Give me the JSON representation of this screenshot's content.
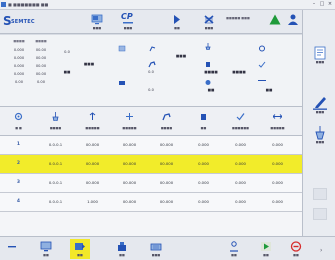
{
  "window": {
    "title": "■ ■■■■■■■ ■■",
    "controls": [
      "–",
      "□",
      "×"
    ]
  },
  "logo": {
    "letter": "S",
    "text": "SEMTEC"
  },
  "toolbar": {
    "items": [
      {
        "label": "■■■",
        "icon": "display-icon"
      },
      {
        "label": "■■■",
        "icon": "cp-icon",
        "glyph": "CP"
      },
      {
        "label": "■■",
        "icon": "arrow-right-icon"
      },
      {
        "label": "■■■",
        "icon": "trash-icon"
      },
      {
        "label": "■■■■■",
        "icon": "status-text"
      },
      {
        "label": "■■",
        "icon": "warning-triangle-icon"
      },
      {
        "label": "■■■",
        "icon": "user-icon"
      }
    ],
    "status_text": "■■■■■ ■■■"
  },
  "panel": {
    "left_headers": [
      "■■■■",
      "■■■■"
    ],
    "left_rows": [
      [
        "0.000",
        "00.00"
      ],
      [
        "0.000",
        "00.00"
      ],
      [
        "0.000",
        "00.00"
      ],
      [
        "0.000",
        "00.00"
      ],
      [
        "0.00",
        "0.00"
      ]
    ],
    "mid_values": [
      "0.0",
      "■■",
      "■■■",
      "■■■",
      "0.0",
      "0.0",
      "■■■■",
      "■■■■",
      "■■",
      "■■"
    ],
    "accent": "#3a6ec8"
  },
  "headers": {
    "labels": [
      "■ ■",
      "■■■■",
      "■■■■■",
      "■■■■■",
      "■■■■",
      "■■",
      "■■■■■■",
      "■■■■■"
    ]
  },
  "table": {
    "rows": [
      {
        "idx": "1",
        "cells": [
          "0.0.0.1",
          "00.000",
          "00.000",
          "00.000",
          "0.000",
          "0.000",
          "0.000"
        ]
      },
      {
        "idx": "2",
        "cells": [
          "0.0.0.1",
          "00.000",
          "00.000",
          "00.000",
          "0.000",
          "0.000",
          "0.000"
        ],
        "selected": true
      },
      {
        "idx": "3",
        "cells": [
          "0.0.0.1",
          "00.000",
          "00.000",
          "00.000",
          "0.000",
          "0.000",
          "0.000"
        ]
      },
      {
        "idx": "4",
        "cells": [
          "0.0.0.1",
          "1.000",
          "00.000",
          "00.000",
          "0.000",
          "0.000",
          "0.000"
        ]
      }
    ],
    "selected_color": "#f2ec2a"
  },
  "rightbar": {
    "items": [
      {
        "label": "■■■",
        "icon": "document-icon"
      },
      {
        "label": "■■■",
        "icon": "edit-pen-icon"
      },
      {
        "label": "■■■",
        "icon": "tool-icon"
      }
    ]
  },
  "bottombar": {
    "items": [
      {
        "label": "■■",
        "icon": "minus-icon"
      },
      {
        "label": "■■",
        "icon": "monitor-icon"
      },
      {
        "label": "■■",
        "icon": "program-icon",
        "active": true
      },
      {
        "label": "■■",
        "icon": "robot-icon"
      },
      {
        "label": "■■■",
        "icon": "keyboard-icon"
      },
      {
        "label": "■■",
        "icon": "person-icon"
      },
      {
        "label": "■■",
        "icon": "play-icon"
      },
      {
        "label": "■■",
        "icon": "stop-icon"
      }
    ]
  }
}
